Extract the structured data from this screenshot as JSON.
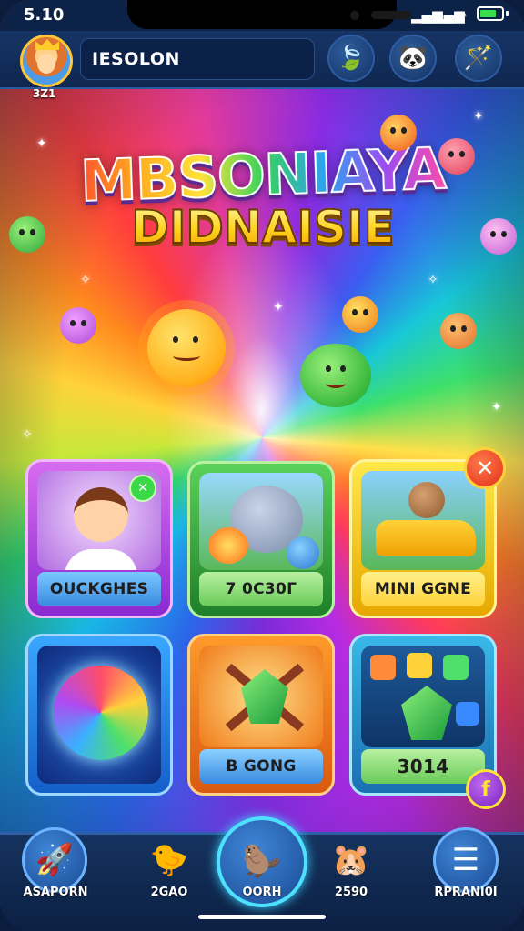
{
  "status_bar": {
    "time": "5.10",
    "battery_level": 0.75
  },
  "header": {
    "player_name": "IESOLON",
    "player_level": "3Z1",
    "buttons": [
      {
        "name": "leaf-button",
        "icon": "leaf-icon",
        "glyph": "🍃"
      },
      {
        "name": "pet-button",
        "icon": "panda-icon",
        "glyph": "🐼"
      },
      {
        "name": "magic-wand-button",
        "icon": "wand-icon",
        "glyph": "🪄"
      }
    ]
  },
  "title": {
    "line1": "MBSONIAYA",
    "line2": "DIDNAISIE"
  },
  "tiles": [
    {
      "label": "OUCKGHES",
      "art": "waving-boy"
    },
    {
      "label": "7 0C30Γ",
      "art": "fire-breathing-creature"
    },
    {
      "label": "MINI GGNE",
      "art": "bear-in-car"
    },
    {
      "label": "",
      "art": "rainbow-orb"
    },
    {
      "label": "B GONG",
      "art": "emerald-with-swords"
    },
    {
      "label": "3014",
      "art": "gem-puzzle"
    }
  ],
  "badges": {
    "close": "✕",
    "check": "✕",
    "bonus": "f"
  },
  "bottom_nav": [
    {
      "label": "ASAPORN",
      "icon": "rocket-icon",
      "glyph": "🚀"
    },
    {
      "label": "2GAO",
      "icon": "bird-icon",
      "glyph": "🐤"
    },
    {
      "label": "OORH",
      "icon": "beaver-icon",
      "glyph": "🦫"
    },
    {
      "label": "2590",
      "icon": "hamster-icon",
      "glyph": "🐹"
    },
    {
      "label": "RPRANI0I",
      "icon": "menu-icon",
      "glyph": "☰"
    }
  ],
  "colors": {
    "accent_gold": "#ffd23a",
    "nav_blue": "#15335f",
    "glow_cyan": "#4ee0ff"
  }
}
